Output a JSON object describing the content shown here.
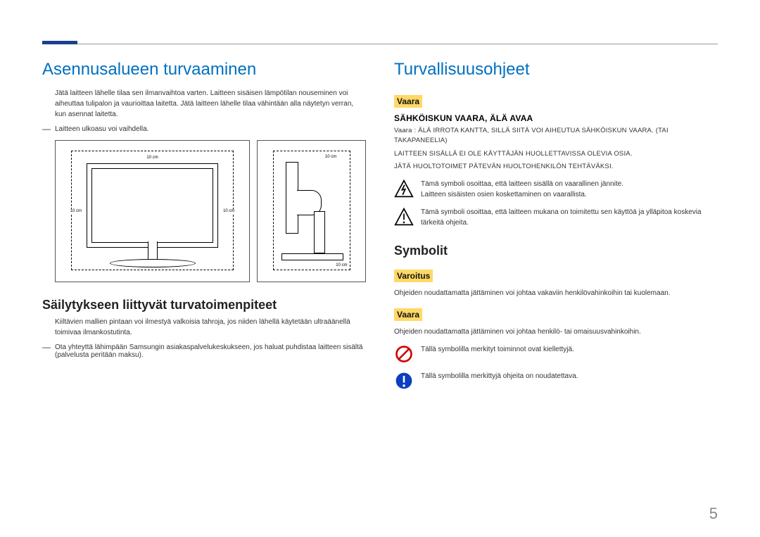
{
  "page_number": "5",
  "left": {
    "h1": "Asennusalueen turvaaminen",
    "intro": "Jätä laitteen lähelle tilaa sen ilmanvaihtoa varten. Laitteen sisäisen lämpötilan nouseminen voi aiheuttaa tulipalon ja vaurioittaa laitetta. Jätä laitteen lähelle tilaa vähintään alla näytetyn verran, kun asennat laitetta.",
    "note1": "Laitteen ulkoasu voi vaihdella.",
    "dims": {
      "d10cm": "10 cm"
    },
    "h2": "Säilytykseen liittyvät turvatoimenpiteet",
    "storage_body": "Kiiltävien mallien pintaan voi ilmestyä valkoisia tahroja, jos niiden lähellä käytetään ultraäänellä toimivaa ilmankostutinta.",
    "note2": "Ota yhteyttä lähimpään Samsungin asiakaspalvelukeskukseen, jos haluat puhdistaa laitteen sisältä (palvelusta peritään maksu)."
  },
  "right": {
    "h1": "Turvallisuusohjeet",
    "vaara_label": "Vaara",
    "varoitus_label": "Varoitus",
    "shock_heading": "SÄHKÖISKUN VAARA, ÄLÄ AVAA",
    "shock_l1": "Vaara : ÄLÄ IRROTA KANTTA, SILLÄ SIITÄ VOI AIHEUTUA SÄHKÖISKUN VAARA. (TAI TAKAPANEELIA)",
    "shock_l2": "LAITTEEN SISÄLLÄ EI OLE KÄYTTÄJÄN HUOLLETTAVISSA OLEVIA OSIA.",
    "shock_l3": "JÄTÄ HUOLTOTOIMET PÄTEVÄN HUOLTOHENKILÖN TEHTÄVÄKSI.",
    "tri_bolt_l1": "Tämä symboli osoittaa, että laitteen sisällä on vaarallinen jännite.",
    "tri_bolt_l2": "Laitteen sisäisten osien koskettaminen on vaarallista.",
    "tri_excl": "Tämä symboli osoittaa, että laitteen mukana on toimitettu sen käyttöä ja ylläpitoa koskevia tärkeitä ohjeita.",
    "symbols_h2": "Symbolit",
    "varoitus_body": "Ohjeiden noudattamatta jättäminen voi johtaa vakaviin henkilövahinkoihin tai kuolemaan.",
    "vaara2_body": "Ohjeiden noudattamatta jättäminen voi johtaa henkilö- tai omaisuusvahinkoihin.",
    "prohibit": "Tällä symbolilla merkityt toiminnot ovat kiellettyjä.",
    "mandatory": "Tällä symbolilla merkittyjä ohjeita on noudatettava."
  }
}
